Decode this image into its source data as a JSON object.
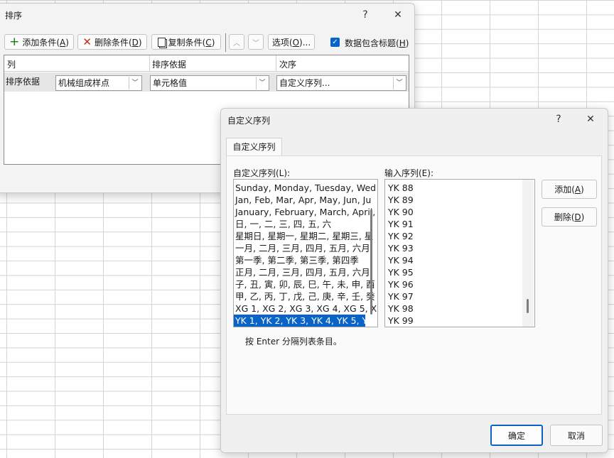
{
  "sort_dialog": {
    "title": "排序",
    "help": "?",
    "close": "✕",
    "toolbar": {
      "add_level_text": "添加条件(",
      "add_level_key": "A",
      "delete_level_text": "删除条件(",
      "delete_level_key": "D",
      "copy_level_text": "复制条件(",
      "copy_level_key": "C",
      "options_text": "选项(",
      "options_key": "O",
      "options_tail": ")...",
      "header_checkbox_text": "数据包含标题(",
      "header_checkbox_key": "H",
      "header_checked": true
    },
    "columns": [
      "列",
      "排序依据",
      "次序"
    ],
    "row": {
      "label": "排序依据",
      "column_value": "机械组成样点",
      "sort_on_value": "单元格值",
      "order_value": "自定义序列..."
    }
  },
  "custom_dialog": {
    "title": "自定义序列",
    "help": "?",
    "close": "✕",
    "tab": "自定义序列",
    "lists_label": "自定义序列(L):",
    "entries_label": "输入序列(E):",
    "lists": [
      "Sunday, Monday, Tuesday, Wed",
      "Jan, Feb, Mar, Apr, May, Jun, Ju",
      "January, February, March, April,",
      "日, 一, 二, 三, 四, 五, 六",
      "星期日, 星期一, 星期二, 星期三, 星",
      "一月, 二月, 三月, 四月, 五月, 六月,",
      "第一季, 第二季, 第三季, 第四季",
      "正月, 二月, 三月, 四月, 五月, 六月,",
      "子, 丑, 寅, 卯, 辰, 巳, 午, 未, 申, 酉",
      "甲, 乙, 丙, 丁, 戊, 己, 庚, 辛, 壬, 癸",
      "XG 1, XG 2, XG 3, XG 4, XG 5, X",
      "YK 1, YK 2, YK 3, YK 4, YK 5, YK"
    ],
    "selected_index": 11,
    "entries": [
      "YK 88",
      "YK 89",
      "YK 90",
      "YK 91",
      "YK 92",
      "YK 93",
      "YK 94",
      "YK 95",
      "YK 96",
      "YK 97",
      "YK 98",
      "YK 99"
    ],
    "add_text": "添加(",
    "add_key": "A",
    "delete_text": "删除(",
    "delete_key": "D",
    "hint": "按 Enter 分隔列表条目。",
    "ok": "确定",
    "cancel": "取消"
  },
  "colors": {
    "accent": "#0a64c8",
    "close_red": "#c42b1c",
    "add_green": "#107c10"
  }
}
